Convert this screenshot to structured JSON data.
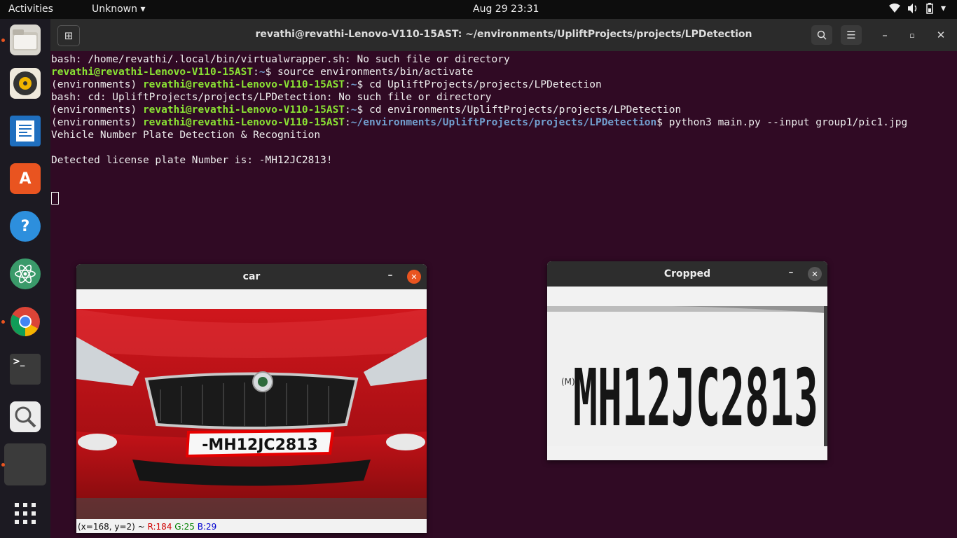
{
  "topbar": {
    "activities": "Activities",
    "app_menu": "Unknown",
    "clock": "Aug 29  23:31"
  },
  "dock": {
    "items": [
      "files",
      "rhythmbox",
      "libreoffice-writer",
      "ubuntu-software",
      "help",
      "atom",
      "chrome",
      "terminal",
      "image-viewer",
      "running-app",
      "show-applications"
    ]
  },
  "terminal": {
    "title": "revathi@revathi-Lenovo-V110-15AST: ~/environments/UpliftProjects/projects/LPDetection",
    "lines": {
      "l1": "bash: /home/revathi/.local/bin/virtualwrapper.sh: No such file or directory",
      "l2_prompt": "revathi@revathi-Lenovo-V110-15AST",
      "l2_sep": ":",
      "l2_path": "~",
      "l2_cmd": "$ source environments/bin/activate",
      "l3_env": "(environments) ",
      "l3_prompt": "revathi@revathi-Lenovo-V110-15AST",
      "l3_path": "~",
      "l3_cmd": "$ cd UpliftProjects/projects/LPDetection",
      "l4": "bash: cd: UpliftProjects/projects/LPDetection: No such file or directory",
      "l5_env": "(environments) ",
      "l5_prompt": "revathi@revathi-Lenovo-V110-15AST",
      "l5_path": "~",
      "l5_cmd": "$ cd environments/UpliftProjects/projects/LPDetection",
      "l6_env": "(environments) ",
      "l6_prompt": "revathi@revathi-Lenovo-V110-15AST",
      "l6_path": "~/environments/UpliftProjects/projects/LPDetection",
      "l6_cmd": "$ python3 main.py --input group1/pic1.jpg",
      "l7": "Vehicle Number Plate Detection & Recognition",
      "l8": "",
      "l9": "Detected license plate Number is: -MH12JC2813!"
    }
  },
  "car_window": {
    "title": "car",
    "plate_text": "-MH12JC2813",
    "status_pos": "(x=168, y=2) ~ ",
    "status_r": "R:184",
    "status_g": "G:25",
    "status_b": "B:29"
  },
  "cropped_window": {
    "title": "Cropped",
    "plate_text": "MH12JC2813"
  },
  "colors": {
    "terminal_bg": "#300a24",
    "prompt_green": "#8ae234",
    "path_blue": "#729fcf",
    "close_orange": "#e95420",
    "car_red": "#c0141a"
  }
}
